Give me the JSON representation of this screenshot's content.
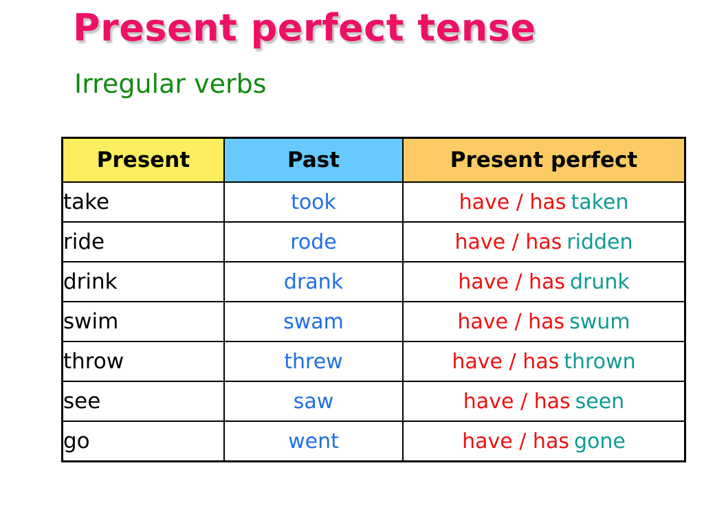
{
  "slide": {
    "title": "Present perfect tense",
    "subtitle": "Irregular verbs",
    "background_color": "#ffffff",
    "title_color": "#ed1165",
    "subtitle_color": "#128a12"
  },
  "table": {
    "headers": {
      "present": "Present",
      "past": "Past",
      "present_perfect": "Present perfect"
    },
    "header_colors": {
      "present": "#fcee5e",
      "past": "#67c9fc",
      "present_perfect": "#fccb64"
    },
    "text_colors": {
      "present": "#000000",
      "past": "#1f6fe8",
      "auxiliary": "#ee1111",
      "participle": "#109a94"
    },
    "auxiliary": "have / has",
    "rows": [
      {
        "present": "take",
        "past": "took",
        "auxiliary": "have / has",
        "participle": "taken"
      },
      {
        "present": "ride",
        "past": "rode",
        "auxiliary": "have / has",
        "participle": "ridden"
      },
      {
        "present": "drink",
        "past": "drank",
        "auxiliary": "have / has",
        "participle": "drunk"
      },
      {
        "present": "swim",
        "past": "swam",
        "auxiliary": "have / has",
        "participle": "swum"
      },
      {
        "present": "throw",
        "past": "threw",
        "auxiliary": "have / has",
        "participle": "thrown"
      },
      {
        "present": "see",
        "past": "saw",
        "auxiliary": "have / has",
        "participle": "seen"
      },
      {
        "present": "go",
        "past": "went",
        "auxiliary": "have / has",
        "participle": "gone"
      }
    ]
  }
}
